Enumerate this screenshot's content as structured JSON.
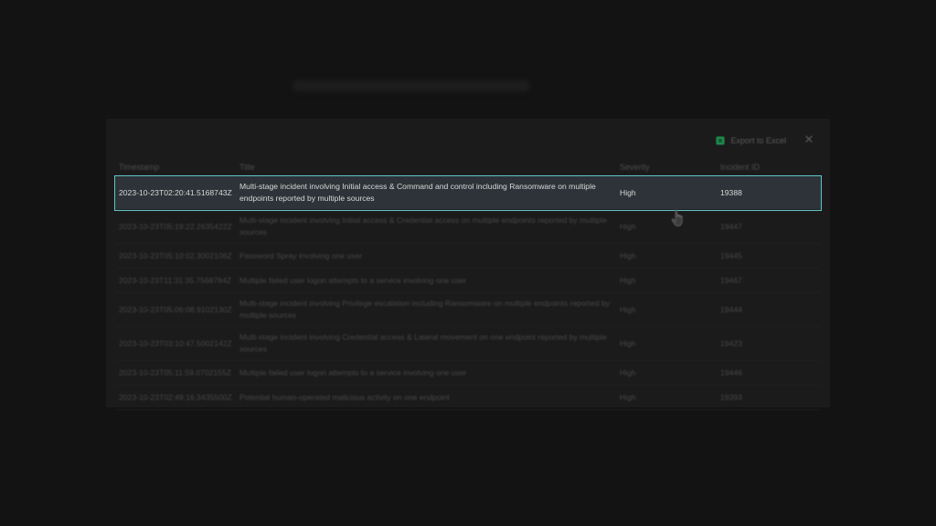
{
  "toolbar": {
    "export_label": "Export to Excel",
    "export_icon": "excel-icon",
    "close_glyph": "✕",
    "close_icon": "close-icon"
  },
  "table": {
    "columns": [
      "Timestamp",
      "Title",
      "Severity",
      "Incident ID"
    ],
    "rows": [
      {
        "timestamp": "2023-10-23T02:20:41.5168743Z",
        "title": "Multi-stage incident involving Initial access & Command and control including Ransomware on multiple endpoints reported by multiple sources",
        "severity": "High",
        "incident_id": "19388",
        "selected": true
      },
      {
        "timestamp": "2023-10-23T05:19:22.2635422Z",
        "title": "Multi-stage incident involving Initial access & Credential access on multiple endpoints reported by multiple sources",
        "severity": "High",
        "incident_id": "19447"
      },
      {
        "timestamp": "2023-10-23T05:10:02.3002106Z",
        "title": "Password Spray involving one user",
        "severity": "High",
        "incident_id": "19445"
      },
      {
        "timestamp": "2023-10-23T11:31:35.7568784Z",
        "title": "Multiple failed user logon attempts to a service involving one user",
        "severity": "High",
        "incident_id": "19467"
      },
      {
        "timestamp": "2023-10-23T05:06:08.9102130Z",
        "title": "Multi-stage incident involving Privilege escalation including Ransomware on multiple endpoints reported by multiple sources",
        "severity": "High",
        "incident_id": "19444"
      },
      {
        "timestamp": "2023-10-23T03:10:47.5002142Z",
        "title": "Multi-stage incident involving Credential access & Lateral movement on one endpoint reported by multiple sources",
        "severity": "High",
        "incident_id": "19423"
      },
      {
        "timestamp": "2023-10-23T05:11:59.0702155Z",
        "title": "Multiple failed user logon attempts to a service involving one user",
        "severity": "High",
        "incident_id": "19446"
      },
      {
        "timestamp": "2023-10-23T02:49:16.3435500Z",
        "title": "Potential human-operated malicious activity on one endpoint",
        "severity": "High",
        "incident_id": "19393"
      }
    ]
  },
  "colors": {
    "selection_outline": "#5fc4c7",
    "selection_bg": "#2d3338",
    "excel_green": "#1f8f4e"
  }
}
